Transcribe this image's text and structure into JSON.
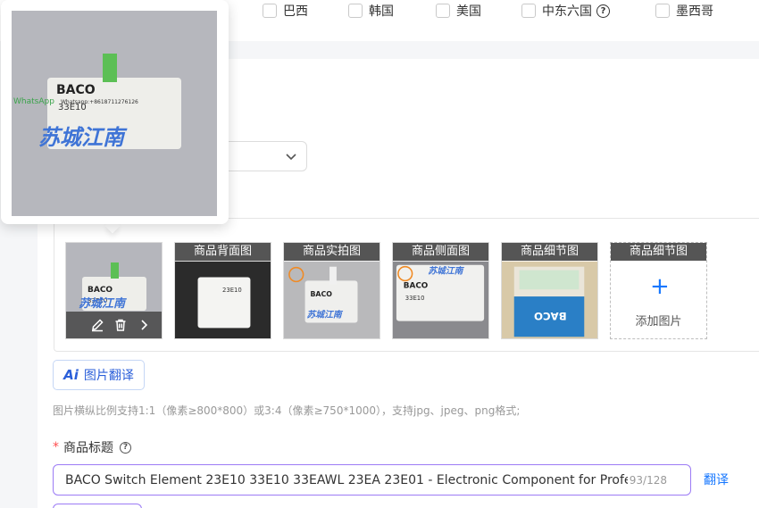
{
  "countries": [
    {
      "label": "巴西"
    },
    {
      "label": "韩国"
    },
    {
      "label": "美国"
    },
    {
      "label": "中东六国"
    },
    {
      "label": "墨西哥"
    }
  ],
  "help_glyph": "?",
  "gallery": {
    "thumbs": [
      {
        "label": ""
      },
      {
        "label": "商品背面图"
      },
      {
        "label": "商品实拍图"
      },
      {
        "label": "商品侧面图"
      },
      {
        "label": "商品细节图"
      },
      {
        "label": "商品细节图"
      }
    ],
    "add_label": "添加图片",
    "plus": "+"
  },
  "watermark": {
    "brand": "BACO",
    "overlay_text": "苏城江南",
    "whatsapp": "WhatsApp",
    "contact": "Whatsapp:+8618711276126",
    "part": "33E10",
    "alt_part": "23E10"
  },
  "ai_translate": {
    "mark": "Ai",
    "label": "图片翻译"
  },
  "hint": "图片横纵比例支持1:1（像素≥800*800）或3:4（像素≥750*1000），支持jpg、jpeg、png格式;",
  "title_field": {
    "required_mark": "*",
    "label": "商品标题",
    "value": "BACO Switch Element 23E10 33E10 33EAWL 23EA 23E01 - Electronic Component for Profess",
    "counter": "93/128"
  },
  "translate_link": "翻译",
  "colors": {
    "accent": "#1677ff",
    "input_border": "#9c7bf5",
    "label_bg": "#555555"
  }
}
